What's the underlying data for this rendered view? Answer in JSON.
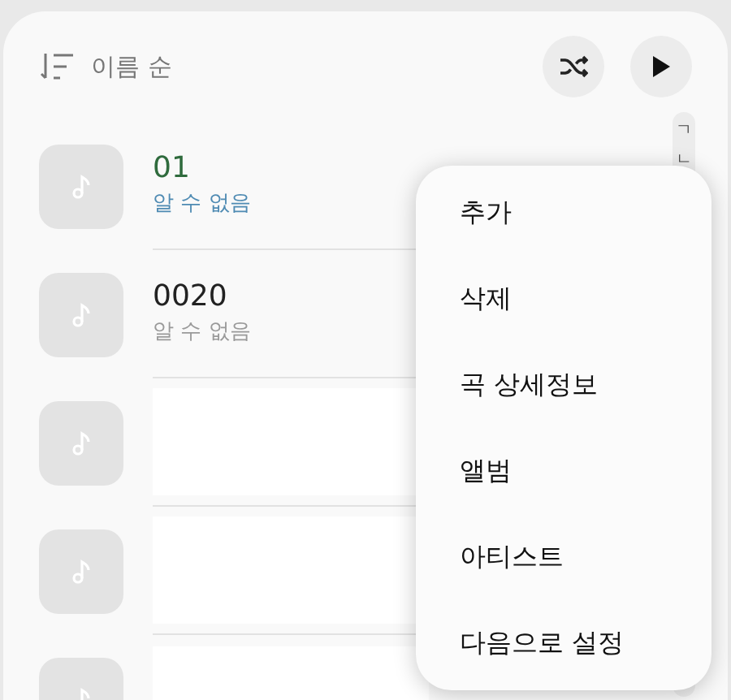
{
  "sort": {
    "label": "이름 순"
  },
  "tracks": [
    {
      "kind": "track",
      "title": "01",
      "artist": "알 수 없음",
      "selected": true
    },
    {
      "kind": "track",
      "title": "0020",
      "artist": "알 수 없음",
      "selected": false
    },
    {
      "kind": "hidden"
    },
    {
      "kind": "hidden"
    },
    {
      "kind": "hidden"
    }
  ],
  "index_letters": [
    "ㄱ",
    "ㄴ"
  ],
  "menu": {
    "items": [
      "추가",
      "삭제",
      "곡 상세정보",
      "앨범",
      "아티스트",
      "다음으로 설정"
    ]
  }
}
